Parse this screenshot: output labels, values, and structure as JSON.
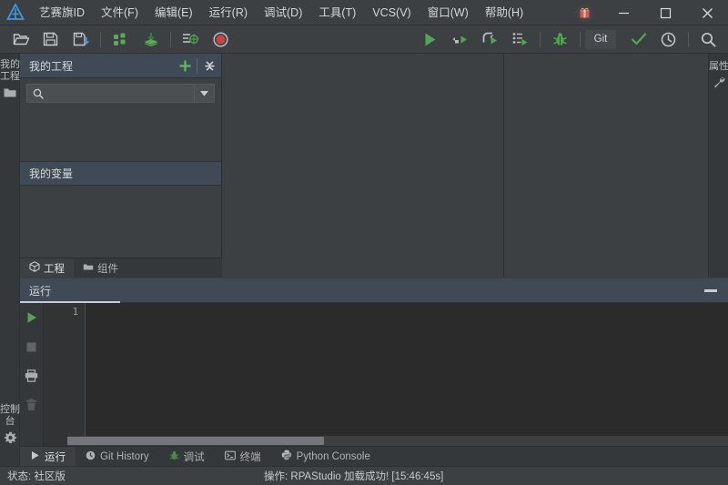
{
  "app": {
    "logo_icon": "aisaiqi-triangle-logo",
    "title": "RPAStudio"
  },
  "menubar": {
    "items": [
      {
        "label": "艺赛旗ID",
        "name": "menu-aisaiqi-id"
      },
      {
        "label": "文件(F)",
        "name": "menu-file"
      },
      {
        "label": "编辑(E)",
        "name": "menu-edit"
      },
      {
        "label": "运行(R)",
        "name": "menu-run"
      },
      {
        "label": "调试(D)",
        "name": "menu-debug"
      },
      {
        "label": "工具(T)",
        "name": "menu-tools"
      },
      {
        "label": "VCS(V)",
        "name": "menu-vcs"
      },
      {
        "label": "窗口(W)",
        "name": "menu-window"
      },
      {
        "label": "帮助(H)",
        "name": "menu-help"
      }
    ],
    "window_controls": {
      "gift_icon": "gift-icon",
      "minimize_icon": "minimize-icon",
      "maximize_icon": "maximize-icon",
      "close_icon": "close-icon"
    }
  },
  "toolbar": {
    "buttons": [
      {
        "name": "open-project-button",
        "icon": "folder-open-icon"
      },
      {
        "name": "save-button",
        "icon": "floppy-save-icon"
      },
      {
        "name": "save-as-button",
        "icon": "floppy-save-as-icon"
      },
      {
        "name": "components-button",
        "icon": "components-grid-icon"
      },
      {
        "name": "install-package-button",
        "icon": "download-layers-icon"
      },
      {
        "name": "element-capture-button",
        "icon": "list-target-icon"
      },
      {
        "name": "record-button",
        "icon": "record-circle-icon"
      },
      {
        "name": "run-button",
        "icon": "play-icon"
      },
      {
        "name": "step-into-button",
        "icon": "step-into-icon"
      },
      {
        "name": "step-over-button",
        "icon": "step-over-icon"
      },
      {
        "name": "step-out-button",
        "icon": "step-out-icon"
      },
      {
        "name": "debug-button",
        "icon": "bug-icon"
      },
      {
        "name": "git-button",
        "icon": "git-label"
      },
      {
        "name": "check-button",
        "icon": "check-icon"
      },
      {
        "name": "history-button",
        "icon": "clock-icon"
      },
      {
        "name": "search-button",
        "icon": "magnifier-icon"
      }
    ],
    "git_label": "Git",
    "accent_green": "#5ea45e",
    "accent_blue": "#4a9ede"
  },
  "left_rail": {
    "top_tab": {
      "label": "我的工程",
      "icon": "folder-icon",
      "name": "rail-my-project"
    },
    "bottom_tab": {
      "label": "控制台",
      "icon": "gear-icon",
      "name": "rail-console"
    }
  },
  "right_rail": {
    "top_tab": {
      "label": "属性",
      "icon": "wrench-icon",
      "name": "rail-properties"
    }
  },
  "project_panel": {
    "header": {
      "title": "我的工程",
      "add_icon": "plus-icon",
      "collapse_icon": "collapse-all-icon"
    },
    "search": {
      "value": "",
      "placeholder": "",
      "icon": "search-icon",
      "caret_icon": "chevron-down-icon"
    },
    "variables_header": {
      "title": "我的变量"
    },
    "tabs": [
      {
        "label": "工程",
        "icon": "cube-icon",
        "active": true,
        "name": "tab-project"
      },
      {
        "label": "组件",
        "icon": "package-icon",
        "active": false,
        "name": "tab-components"
      }
    ]
  },
  "run_panel": {
    "header": {
      "title": "运行",
      "minimize_icon": "minimize-panel-icon"
    },
    "side_buttons": [
      {
        "name": "console-run-button",
        "icon": "play-icon"
      },
      {
        "name": "console-stop-button",
        "icon": "stop-square-icon"
      },
      {
        "name": "console-print-button",
        "icon": "print-icon"
      },
      {
        "name": "console-clear-button",
        "icon": "trash-icon"
      }
    ],
    "console": {
      "line_numbers": [
        "1"
      ],
      "lines": [
        ""
      ]
    },
    "tabs": [
      {
        "label": "运行",
        "icon": "play-icon",
        "active": true,
        "name": "bottom-tab-run"
      },
      {
        "label": "Git History",
        "icon": "clock-icon",
        "active": false,
        "name": "bottom-tab-git-history"
      },
      {
        "label": "调试",
        "icon": "bug-icon",
        "active": false,
        "name": "bottom-tab-debug"
      },
      {
        "label": "终端",
        "icon": "terminal-icon",
        "active": false,
        "name": "bottom-tab-terminal"
      },
      {
        "label": "Python Console",
        "icon": "python-icon",
        "active": false,
        "name": "bottom-tab-python-console"
      }
    ]
  },
  "statusbar": {
    "status_text": "状态: 社区版",
    "operation_text": "操作: RPAStudio 加载成功!  [15:46:45s]"
  }
}
